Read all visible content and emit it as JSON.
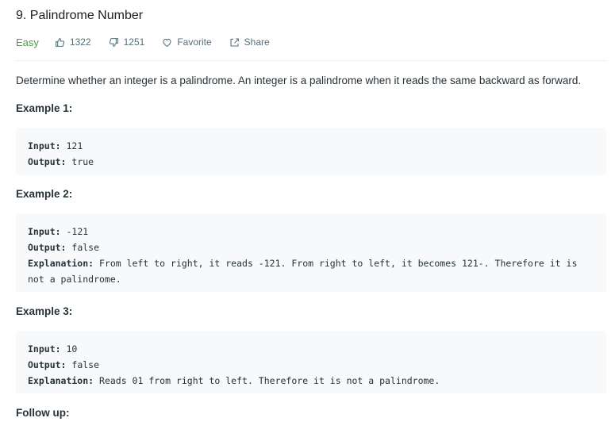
{
  "problem": {
    "title": "9. Palindrome Number",
    "difficulty": "Easy",
    "likes": "1322",
    "dislikes": "1251",
    "favorite_label": "Favorite",
    "share_label": "Share",
    "description": "Determine whether an integer is a palindrome. An integer is a palindrome when it reads the same backward as forward."
  },
  "examples": [
    {
      "title": "Example 1:",
      "input_label": "Input:",
      "input": " 121",
      "output_label": "Output:",
      "output": " true"
    },
    {
      "title": "Example 2:",
      "input_label": "Input:",
      "input": " -121",
      "output_label": "Output:",
      "output": " false",
      "explanation_label": "Explanation:",
      "explanation": " From left to right, it reads -121. From right to left, it becomes 121-. Therefore it is not a palindrome."
    },
    {
      "title": "Example 3:",
      "input_label": "Input:",
      "input": " 10",
      "output_label": "Output:",
      "output": " false",
      "explanation_label": "Explanation:",
      "explanation": " Reads 01 from right to left. Therefore it is not a palindrome."
    }
  ],
  "follow_up": "Follow up:",
  "colors": {
    "easy": "#43a047",
    "code_bg": "#f7f9fa",
    "meta": "#546e7a"
  },
  "icons": [
    "thumbs-up-icon",
    "thumbs-down-icon",
    "heart-icon",
    "share-icon"
  ]
}
